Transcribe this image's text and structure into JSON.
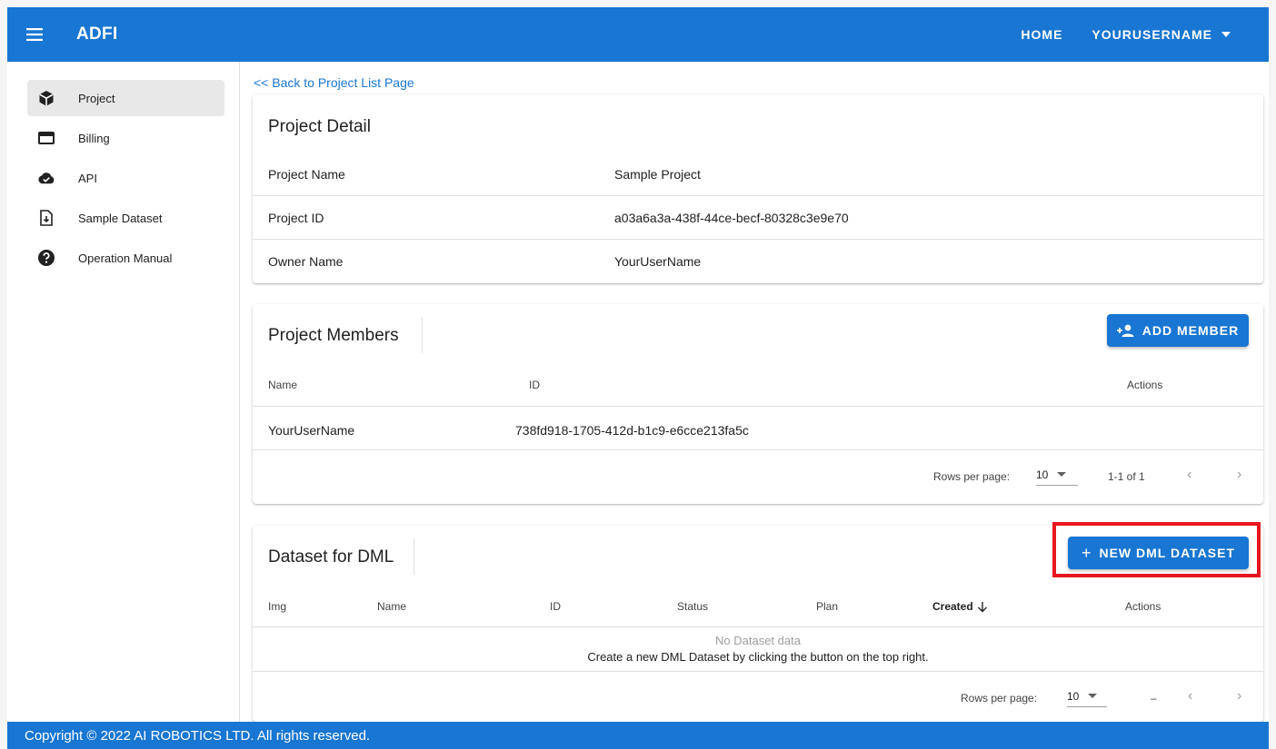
{
  "appbar": {
    "title": "ADFI",
    "home_label": "HOME",
    "user_label": "YOURUSERNAME"
  },
  "sidebar": {
    "items": [
      {
        "label": "Project",
        "icon": "cube-icon"
      },
      {
        "label": "Billing",
        "icon": "credit-card-icon"
      },
      {
        "label": "API",
        "icon": "cloud-check-icon"
      },
      {
        "label": "Sample Dataset",
        "icon": "file-download-icon"
      },
      {
        "label": "Operation Manual",
        "icon": "help-circle-icon"
      }
    ]
  },
  "content": {
    "back_link": "<< Back to Project List Page",
    "project_detail": {
      "title": "Project Detail",
      "rows": [
        {
          "key": "Project Name",
          "value": "Sample Project"
        },
        {
          "key": "Project ID",
          "value": "a03a6a3a-438f-44ce-becf-80328c3e9e70"
        },
        {
          "key": "Owner Name",
          "value": "YourUserName"
        }
      ]
    },
    "project_members": {
      "title": "Project Members",
      "add_button": "ADD MEMBER",
      "headers": {
        "name": "Name",
        "id": "ID",
        "actions": "Actions"
      },
      "rows": [
        {
          "name": "YourUserName",
          "id": "738fd918-1705-412d-b1c9-e6cce213fa5c"
        }
      ],
      "pagination": {
        "rows_per_page_label": "Rows per page:",
        "rows_per_page": "10",
        "range": "1-1 of 1"
      }
    },
    "dml_dataset": {
      "title": "Dataset for DML",
      "new_button": "NEW DML DATASET",
      "headers": {
        "img": "Img",
        "name": "Name",
        "id": "ID",
        "status": "Status",
        "plan": "Plan",
        "created": "Created",
        "actions": "Actions"
      },
      "empty_title": "No Dataset data",
      "empty_hint": "Create a new DML Dataset by clicking the button on the top right.",
      "pagination": {
        "rows_per_page_label": "Rows per page:",
        "rows_per_page": "10",
        "range": "–"
      }
    }
  },
  "footer": {
    "copyright": "Copyright © 2022 AI ROBOTICS LTD. All rights reserved."
  },
  "colors": {
    "primary": "#1976d2",
    "highlight": "#e8161e"
  }
}
